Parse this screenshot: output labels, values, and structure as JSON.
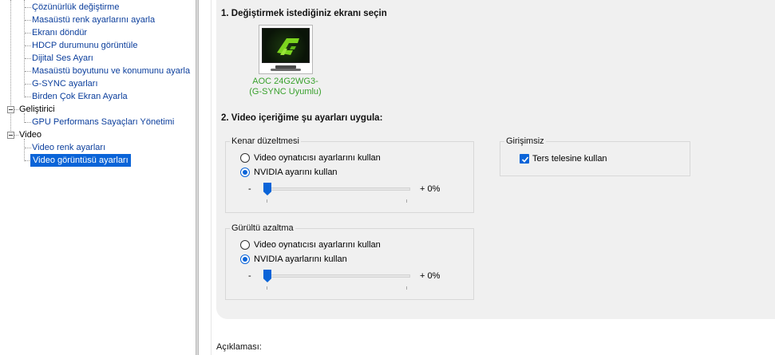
{
  "tree": {
    "items": [
      {
        "label": "Çözünürlük değiştirme",
        "kind": "link"
      },
      {
        "label": "Masaüstü renk ayarlarını ayarla",
        "kind": "link"
      },
      {
        "label": "Ekranı döndür",
        "kind": "link"
      },
      {
        "label": "HDCP durumunu görüntüle",
        "kind": "link"
      },
      {
        "label": "Dijital Ses Ayarı",
        "kind": "link"
      },
      {
        "label": "Masaüstü boyutunu ve konumunu ayarla",
        "kind": "link"
      },
      {
        "label": "G-SYNC ayarları",
        "kind": "link"
      },
      {
        "label": "Birden Çok Ekran Ayarla",
        "kind": "link"
      },
      {
        "label": "Geliştirici",
        "kind": "category"
      },
      {
        "label": "GPU Performans Sayaçları Yönetimi",
        "kind": "link"
      },
      {
        "label": "Video",
        "kind": "category"
      },
      {
        "label": "Video renk ayarları",
        "kind": "link"
      },
      {
        "label": "Video görüntüsü ayarları",
        "kind": "selected"
      }
    ]
  },
  "step1": {
    "title": "1. Değiştirmek istediğiniz ekranı seçin",
    "monitor_name": "AOC 24G2WG3-",
    "monitor_sub": "(G-SYNC Uyumlu)",
    "monitor_icon": "nvidia-monitor-icon"
  },
  "step2": {
    "title": "2. Video içeriğime şu ayarları uygula:",
    "edge": {
      "title": "Kenar düzeltmesi",
      "option1": "Video oynatıcısı ayarlarını kullan",
      "option2": "NVIDIA ayarını kullan",
      "selected": 2,
      "slider_min": "-",
      "slider_max": "+ 0%",
      "slider_value_percent": 0
    },
    "noise": {
      "title": "Gürültü azaltma",
      "option1": "Video oynatıcısı ayarlarını kullan",
      "option2": "NVIDIA ayarlarını kullan",
      "selected": 2,
      "slider_min": "-",
      "slider_max": "+ 0%",
      "slider_value_percent": 0
    },
    "interlace": {
      "title": "Girişimsiz",
      "checkbox_label": "Ters telesine kullan",
      "checked": true
    }
  },
  "footer": {
    "description_label": "Açıklaması:"
  },
  "colors": {
    "accent": "#0a64d8",
    "link": "#0b3e9c",
    "nvidia_green": "#3aa12e",
    "panel_bg": "#f0f0f0"
  }
}
